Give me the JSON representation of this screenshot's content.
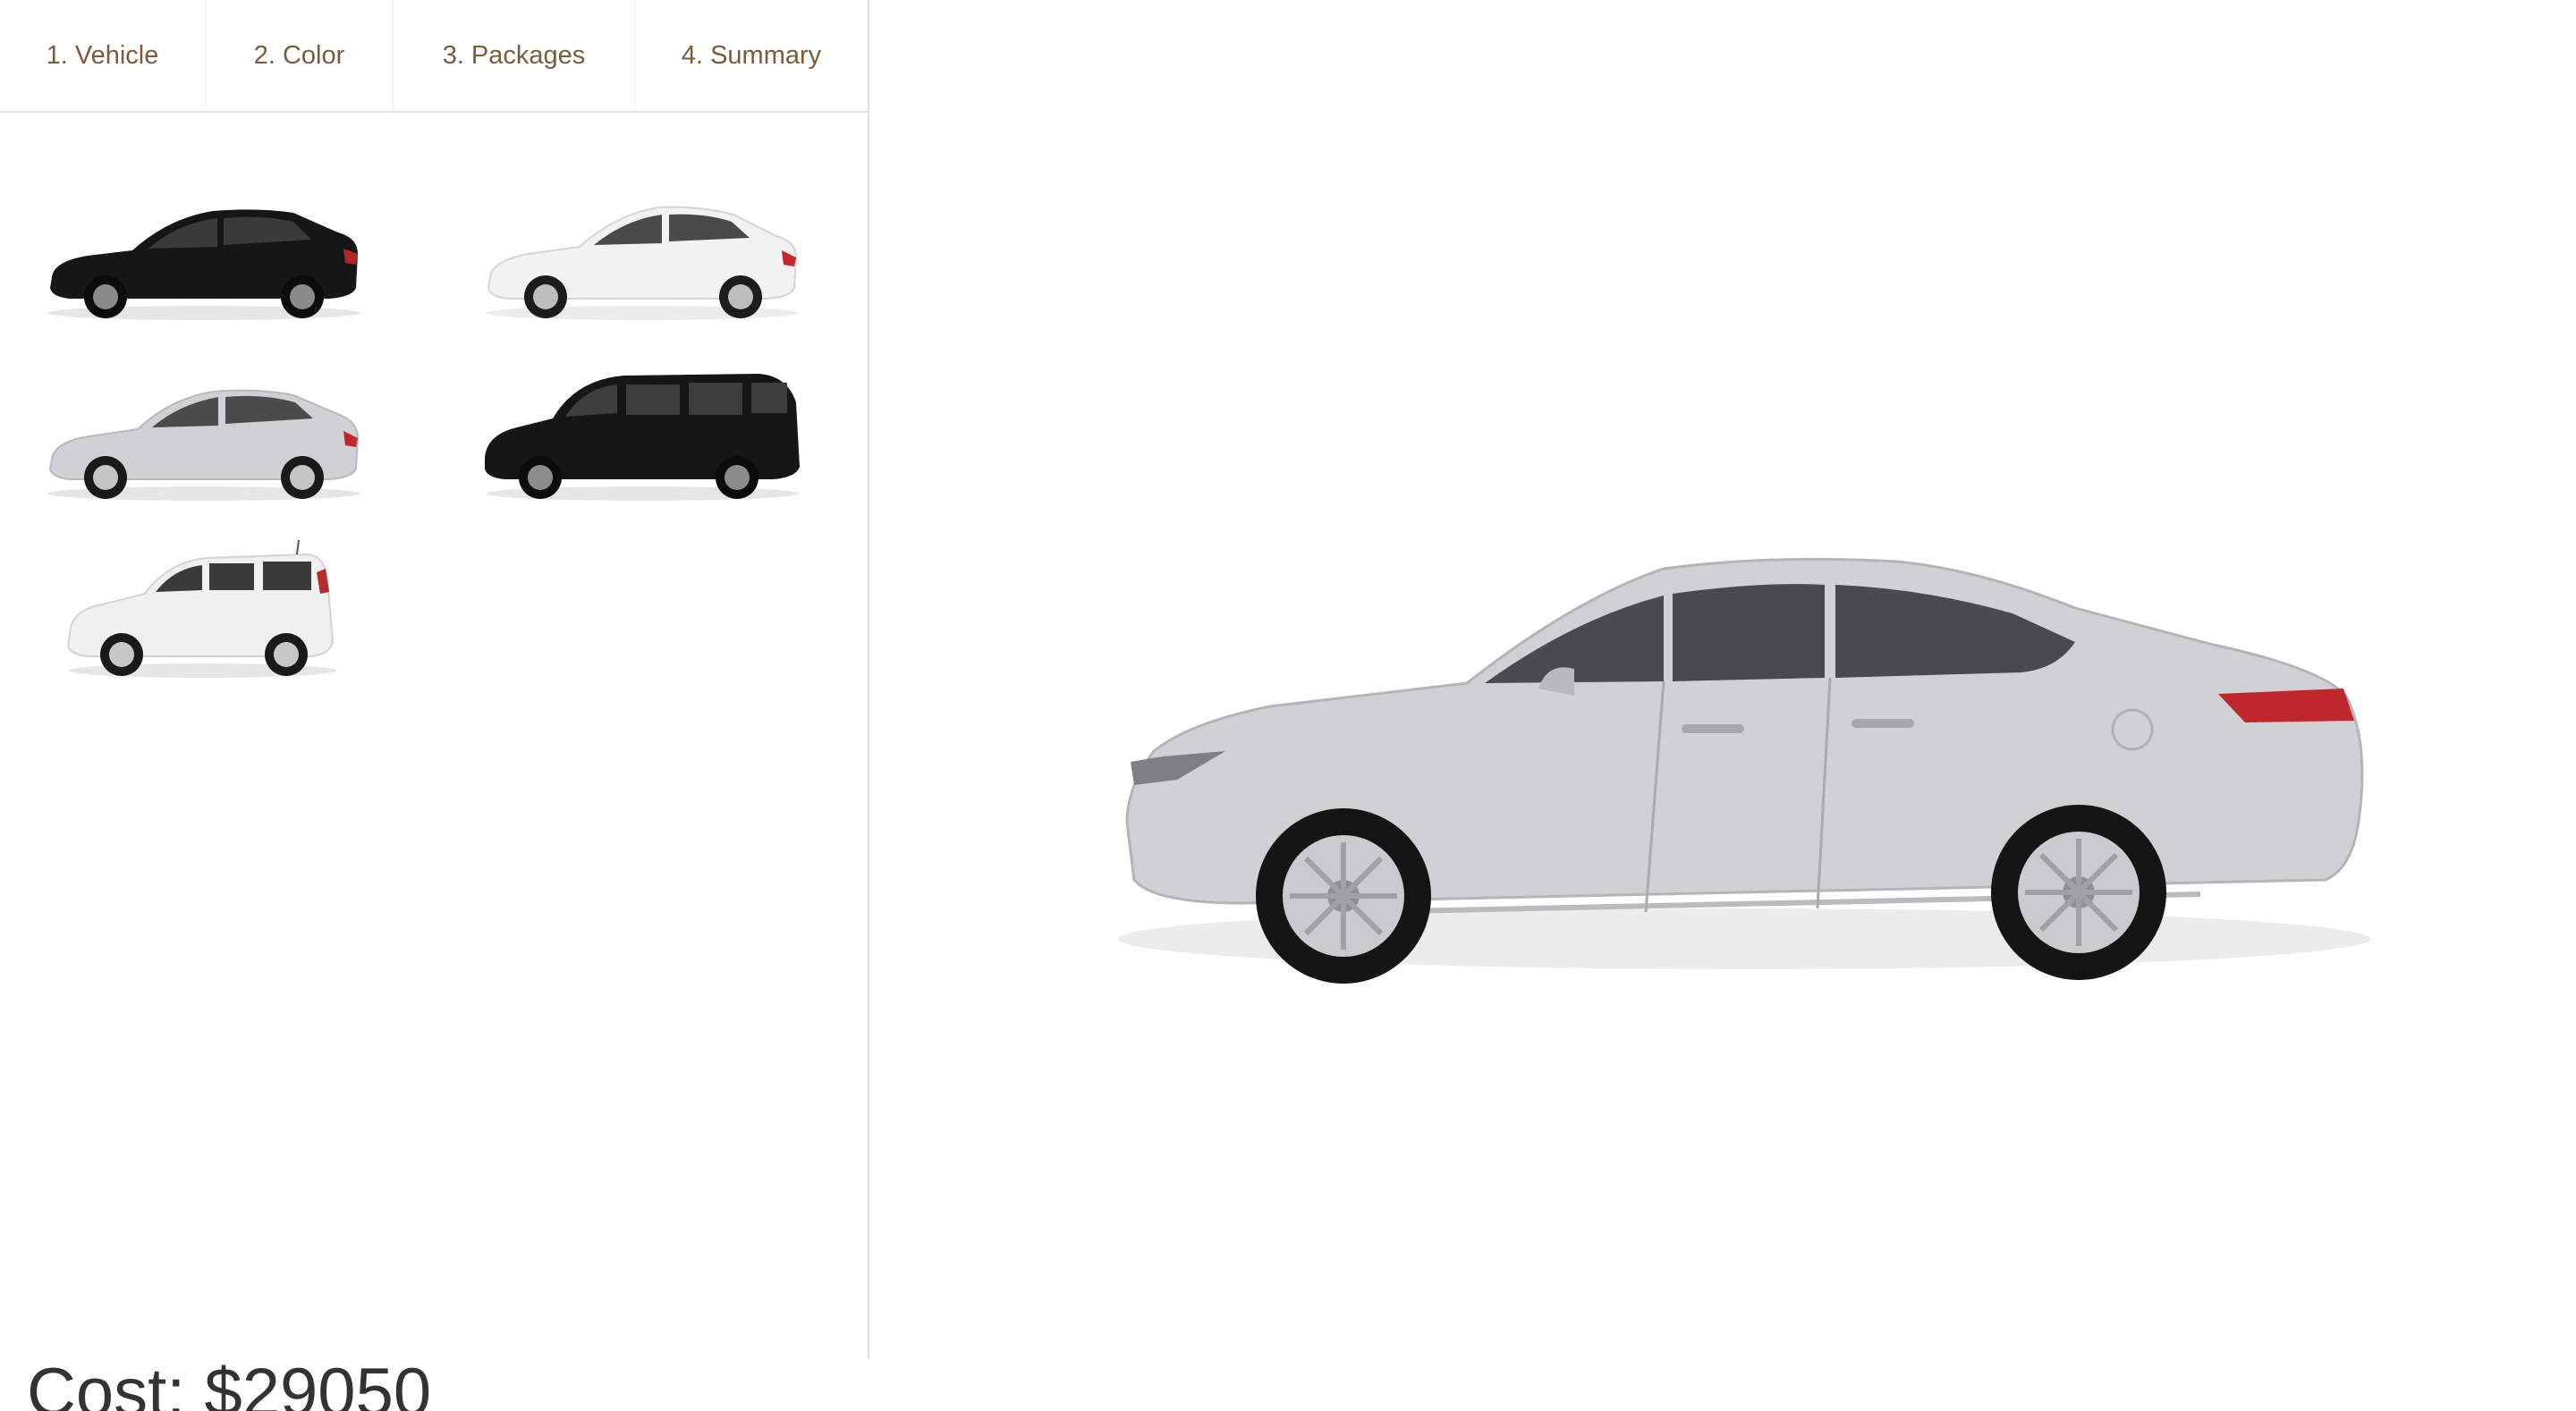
{
  "tabs": [
    {
      "label": "1. Vehicle"
    },
    {
      "label": "2. Color"
    },
    {
      "label": "3. Packages"
    },
    {
      "label": "4. Summary"
    }
  ],
  "colors": {
    "tab_text": "#7a5c3a",
    "divider": "#e2e2e2",
    "cost_text": "#333333",
    "car_black": "#161616",
    "car_white": "#f2f2f2",
    "car_silver": "#cfd1d5"
  },
  "vehicles": [
    {
      "body": "sedan",
      "color": "black",
      "selected": false
    },
    {
      "body": "compact-sedan",
      "color": "white",
      "selected": false
    },
    {
      "body": "sedan",
      "color": "silver",
      "selected": true
    },
    {
      "body": "minivan",
      "color": "black",
      "selected": false
    },
    {
      "body": "crossover-box",
      "color": "white",
      "selected": false
    }
  ],
  "preview": {
    "body": "sedan",
    "color": "silver"
  },
  "cost": {
    "label": "Cost: $29050"
  }
}
